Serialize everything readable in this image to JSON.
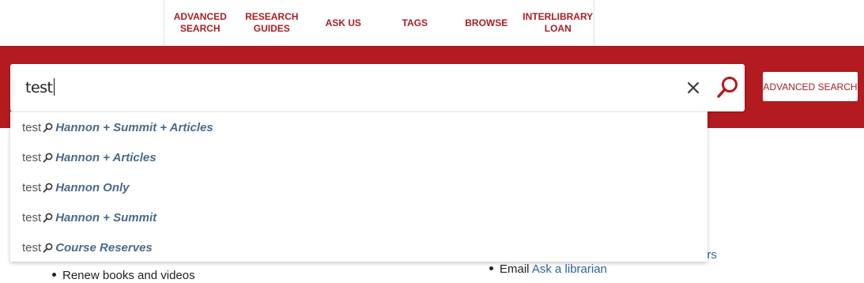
{
  "nav": {
    "items": [
      {
        "label": "ADVANCED\nSEARCH"
      },
      {
        "label": "RESEARCH\nGUIDES"
      },
      {
        "label": "ASK US"
      },
      {
        "label": "TAGS"
      },
      {
        "label": "BROWSE"
      },
      {
        "label": "INTERLIBRARY\nLOAN"
      }
    ]
  },
  "search": {
    "query": "test",
    "clear_icon": "close-icon",
    "search_icon": "search-icon",
    "advanced_label": "ADVANCED SEARCH"
  },
  "suggestions": [
    {
      "term": "test",
      "scope": "Hannon + Summit + Articles"
    },
    {
      "term": "test",
      "scope": "Hannon + Articles"
    },
    {
      "term": "test",
      "scope": "Hannon Only"
    },
    {
      "term": "test",
      "scope": "Hannon + Summit"
    },
    {
      "term": "test",
      "scope": "Course Reserves"
    }
  ],
  "content": {
    "left_item": "Renew books and videos",
    "right_item_prefix": "Email",
    "right_item_link": "Ask a librarian",
    "partial_link": "urs"
  },
  "colors": {
    "brand_red": "#b31b21",
    "nav_text": "#a31f24",
    "link": "#2a6496"
  }
}
